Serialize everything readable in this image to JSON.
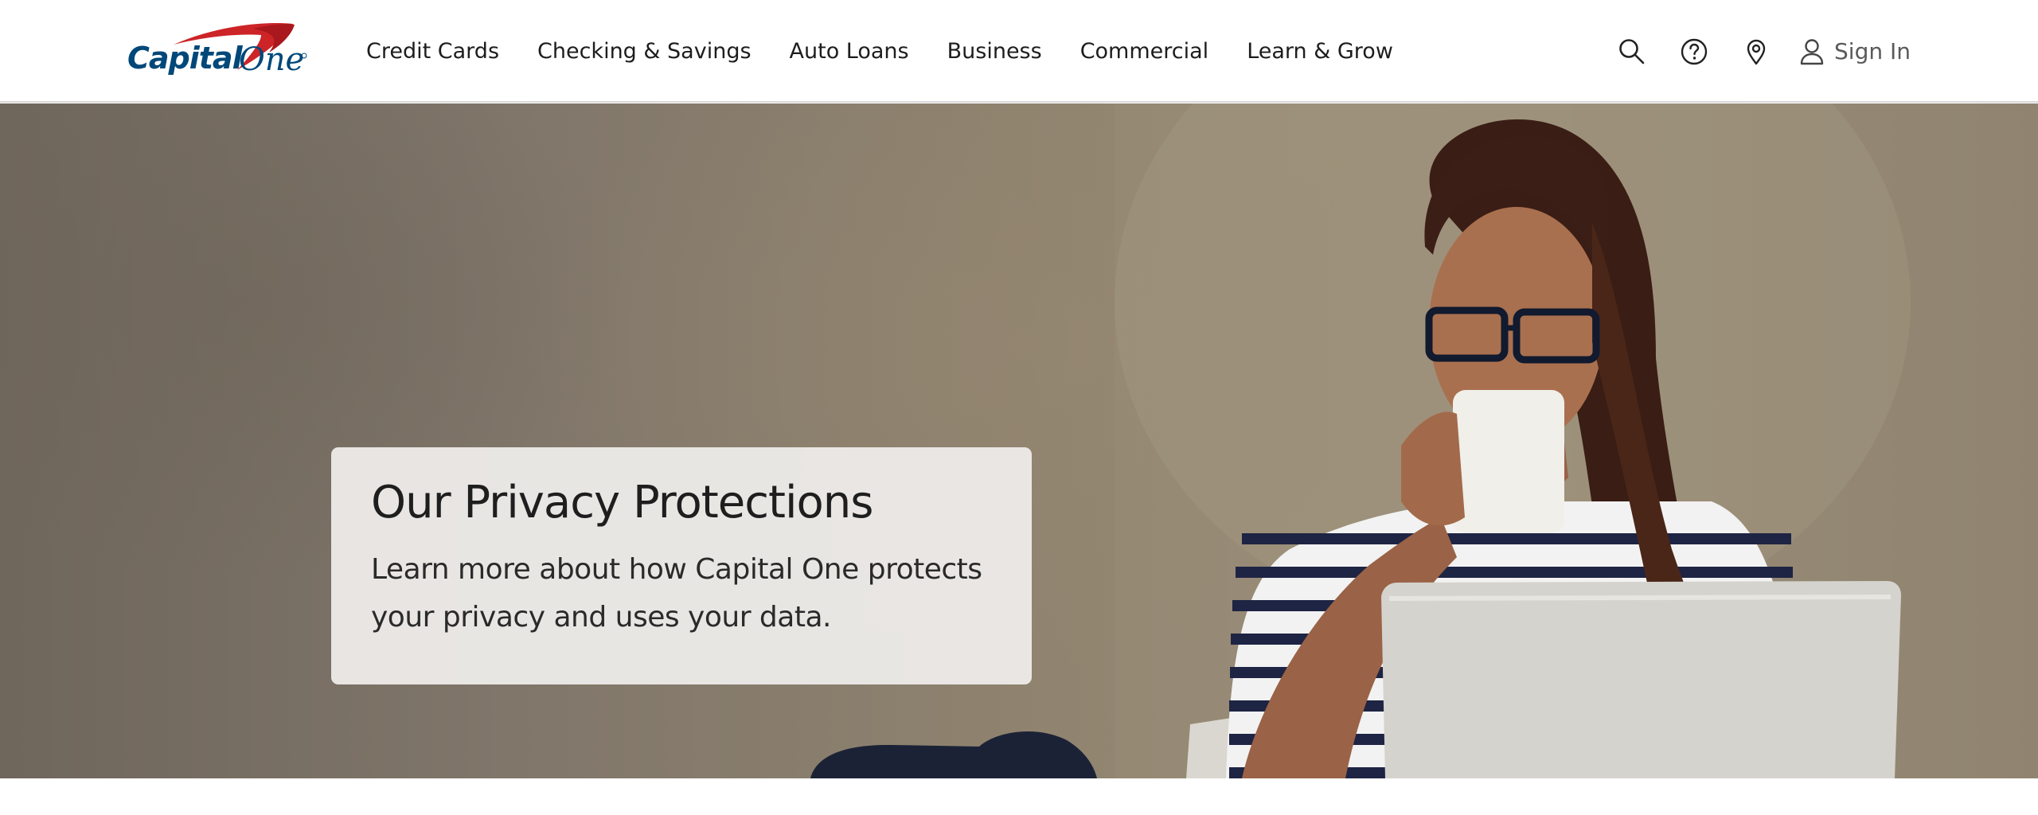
{
  "brand": {
    "logo_text": "Capital One",
    "brand_red": "#cc2427",
    "brand_navy": "#004879"
  },
  "nav": {
    "items": [
      {
        "label": "Credit Cards"
      },
      {
        "label": "Checking & Savings"
      },
      {
        "label": "Auto Loans"
      },
      {
        "label": "Business"
      },
      {
        "label": "Commercial"
      },
      {
        "label": "Learn & Grow"
      }
    ]
  },
  "utility": {
    "icons": [
      "search-icon",
      "help-icon",
      "location-icon",
      "user-icon"
    ],
    "sign_in_label": "Sign In"
  },
  "hero": {
    "title": "Our Privacy Protections",
    "body": "Learn more about how Capital One protects your privacy and uses your data.",
    "card_color": "#ecebe9"
  }
}
